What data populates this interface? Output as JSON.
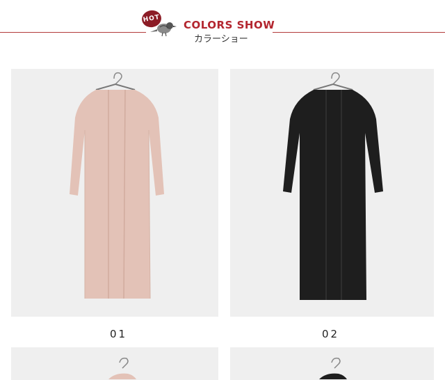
{
  "header": {
    "badge": "HOT",
    "title": "COLORS SHOW",
    "subtitle": "カラーショー",
    "accent_color": "#b3262f"
  },
  "products": [
    {
      "label": "01",
      "color_name": "pink",
      "swatch": "#e3c2b7"
    },
    {
      "label": "02",
      "color_name": "black",
      "swatch": "#1e1e1e"
    },
    {
      "label": "",
      "color_name": "",
      "swatch": "#e3c2b7"
    },
    {
      "label": "",
      "color_name": "",
      "swatch": "#1e1e1e"
    }
  ],
  "icons": {
    "badge_icon": "hot-badge-icon",
    "bird_icon": "bird-icon",
    "hanger_icon": "hanger-icon"
  }
}
